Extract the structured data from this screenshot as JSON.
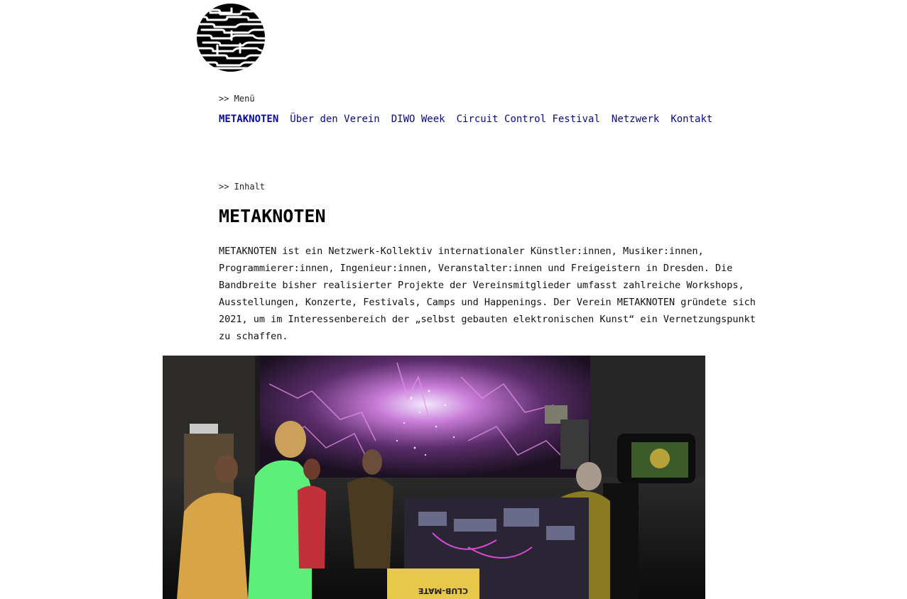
{
  "menu": {
    "marker": ">> Menü",
    "items": [
      {
        "label": "METAKNOTEN",
        "active": true
      },
      {
        "label": "Über den Verein",
        "active": false
      },
      {
        "label": "DIWO Week",
        "active": false
      },
      {
        "label": "Circuit Control Festival",
        "active": false
      },
      {
        "label": "Netzwerk",
        "active": false
      },
      {
        "label": "Kontakt",
        "active": false
      }
    ]
  },
  "content": {
    "marker": ">> Inhalt",
    "title": "METAKNOTEN",
    "intro": "METAKNOTEN ist ein Netzwerk-Kollektiv internationaler Künstler:innen, Musiker:innen, Programmierer:innen, Ingenieur:innen, Veranstalter:innen und Freigeistern in Dresden. Die Bandbreite bisher realisierter Projekte der Vereinsmitglieder umfasst zahlreiche Workshops, Ausstellungen, Konzerte, Festivals, Camps und Happenings. Der Verein METAKNOTEN gründete sich 2021, um im Interessenbereich der „selbst gebauten elektronischen Kunst“ ein Vernetzungspunkt zu schaffen."
  },
  "photo": {
    "crate_label": "CLUB-MATE"
  },
  "colors": {
    "link": "#0a0a7a",
    "text": "#000000",
    "background": "#ffffff"
  },
  "icons": {
    "logo": "circuit-knot-logo"
  }
}
